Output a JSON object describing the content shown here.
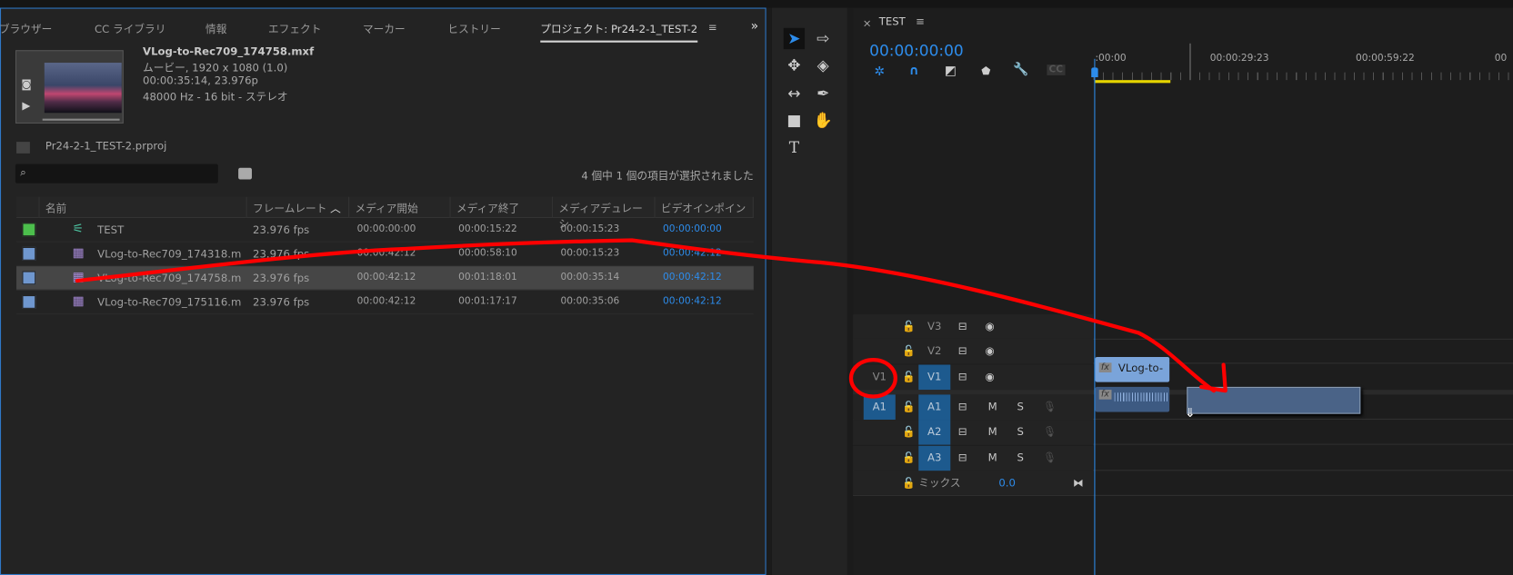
{
  "project_panel": {
    "tabs": [
      "ブラウザー",
      "CC ライブラリ",
      "情報",
      "エフェクト",
      "マーカー",
      "ヒストリー",
      "プロジェクト: Pr24-2-1_TEST-2"
    ],
    "menu_icon": "hamburger-icon",
    "overflow_icon": "double-chevron-right-icon",
    "preview": {
      "filename": "VLog-to-Rec709_174758.mxf",
      "line1": "ムービー, 1920 x 1080 (1.0)",
      "line2": "00:00:35:14, 23.976p",
      "line3": "48000 Hz - 16 bit - ステレオ"
    },
    "project_file": "Pr24-2-1_TEST-2.prproj",
    "search": {
      "value": "",
      "placeholder": ""
    },
    "selection_status": "4 個中 1 個の項目が選択されました",
    "columns": [
      "名前",
      "フレームレート",
      "メディア開始",
      "メディア終了",
      "メディアデュレーシ",
      "ビデオインポイント"
    ],
    "sort_column": "フレームレート",
    "rows": [
      {
        "color": "#4cbf4c",
        "icon": "sequence-icon",
        "name": "TEST",
        "fps": "23.976 fps",
        "start": "00:00:00:00",
        "end": "00:00:15:22",
        "duration": "00:00:15:23",
        "vin": "00:00:00:00",
        "selected": false
      },
      {
        "color": "#6f97cf",
        "icon": "clip-icon",
        "name": "VLog-to-Rec709_174318.m",
        "fps": "23.976 fps",
        "start": "00:00:42:12",
        "end": "00:00:58:10",
        "duration": "00:00:15:23",
        "vin": "00:00:42:12",
        "selected": false
      },
      {
        "color": "#6f97cf",
        "icon": "clip-icon",
        "name": "VLog-to-Rec709_174758.m",
        "fps": "23.976 fps",
        "start": "00:00:42:12",
        "end": "00:01:18:01",
        "duration": "00:00:35:14",
        "vin": "00:00:42:12",
        "selected": true
      },
      {
        "color": "#6f97cf",
        "icon": "clip-icon",
        "name": "VLog-to-Rec709_175116.m",
        "fps": "23.976 fps",
        "start": "00:00:42:12",
        "end": "00:01:17:17",
        "duration": "00:00:35:06",
        "vin": "00:00:42:12",
        "selected": false
      }
    ]
  },
  "tools": [
    "selection-tool",
    "track-select-tool",
    "ripple-edit-tool",
    "razor-tool",
    "slip-tool",
    "pen-tool",
    "rectangle-tool",
    "hand-tool",
    "type-tool"
  ],
  "timeline": {
    "close": "×",
    "title": "TEST",
    "timecode": "00:00:00:00",
    "ruler": [
      ":00:00",
      "00:00:29:23",
      "00:00:59:22",
      "00"
    ],
    "tracks": [
      {
        "id": "V3",
        "type": "video"
      },
      {
        "id": "V2",
        "type": "video"
      },
      {
        "id": "V1",
        "type": "video",
        "source": "V1"
      },
      {
        "id": "A1",
        "type": "audio",
        "source": "A1"
      },
      {
        "id": "A2",
        "type": "audio"
      },
      {
        "id": "A3",
        "type": "audio"
      }
    ],
    "mute": "M",
    "solo": "S",
    "mix": {
      "label": "ミックス",
      "value": "0.0"
    },
    "clip_label": "VLog-to-",
    "fx": "fx"
  },
  "colors": {
    "accent": "#2d8ceb",
    "annotation": "#ff0000",
    "playhead": "#2d8ceb",
    "work_area": "#e5d400"
  }
}
